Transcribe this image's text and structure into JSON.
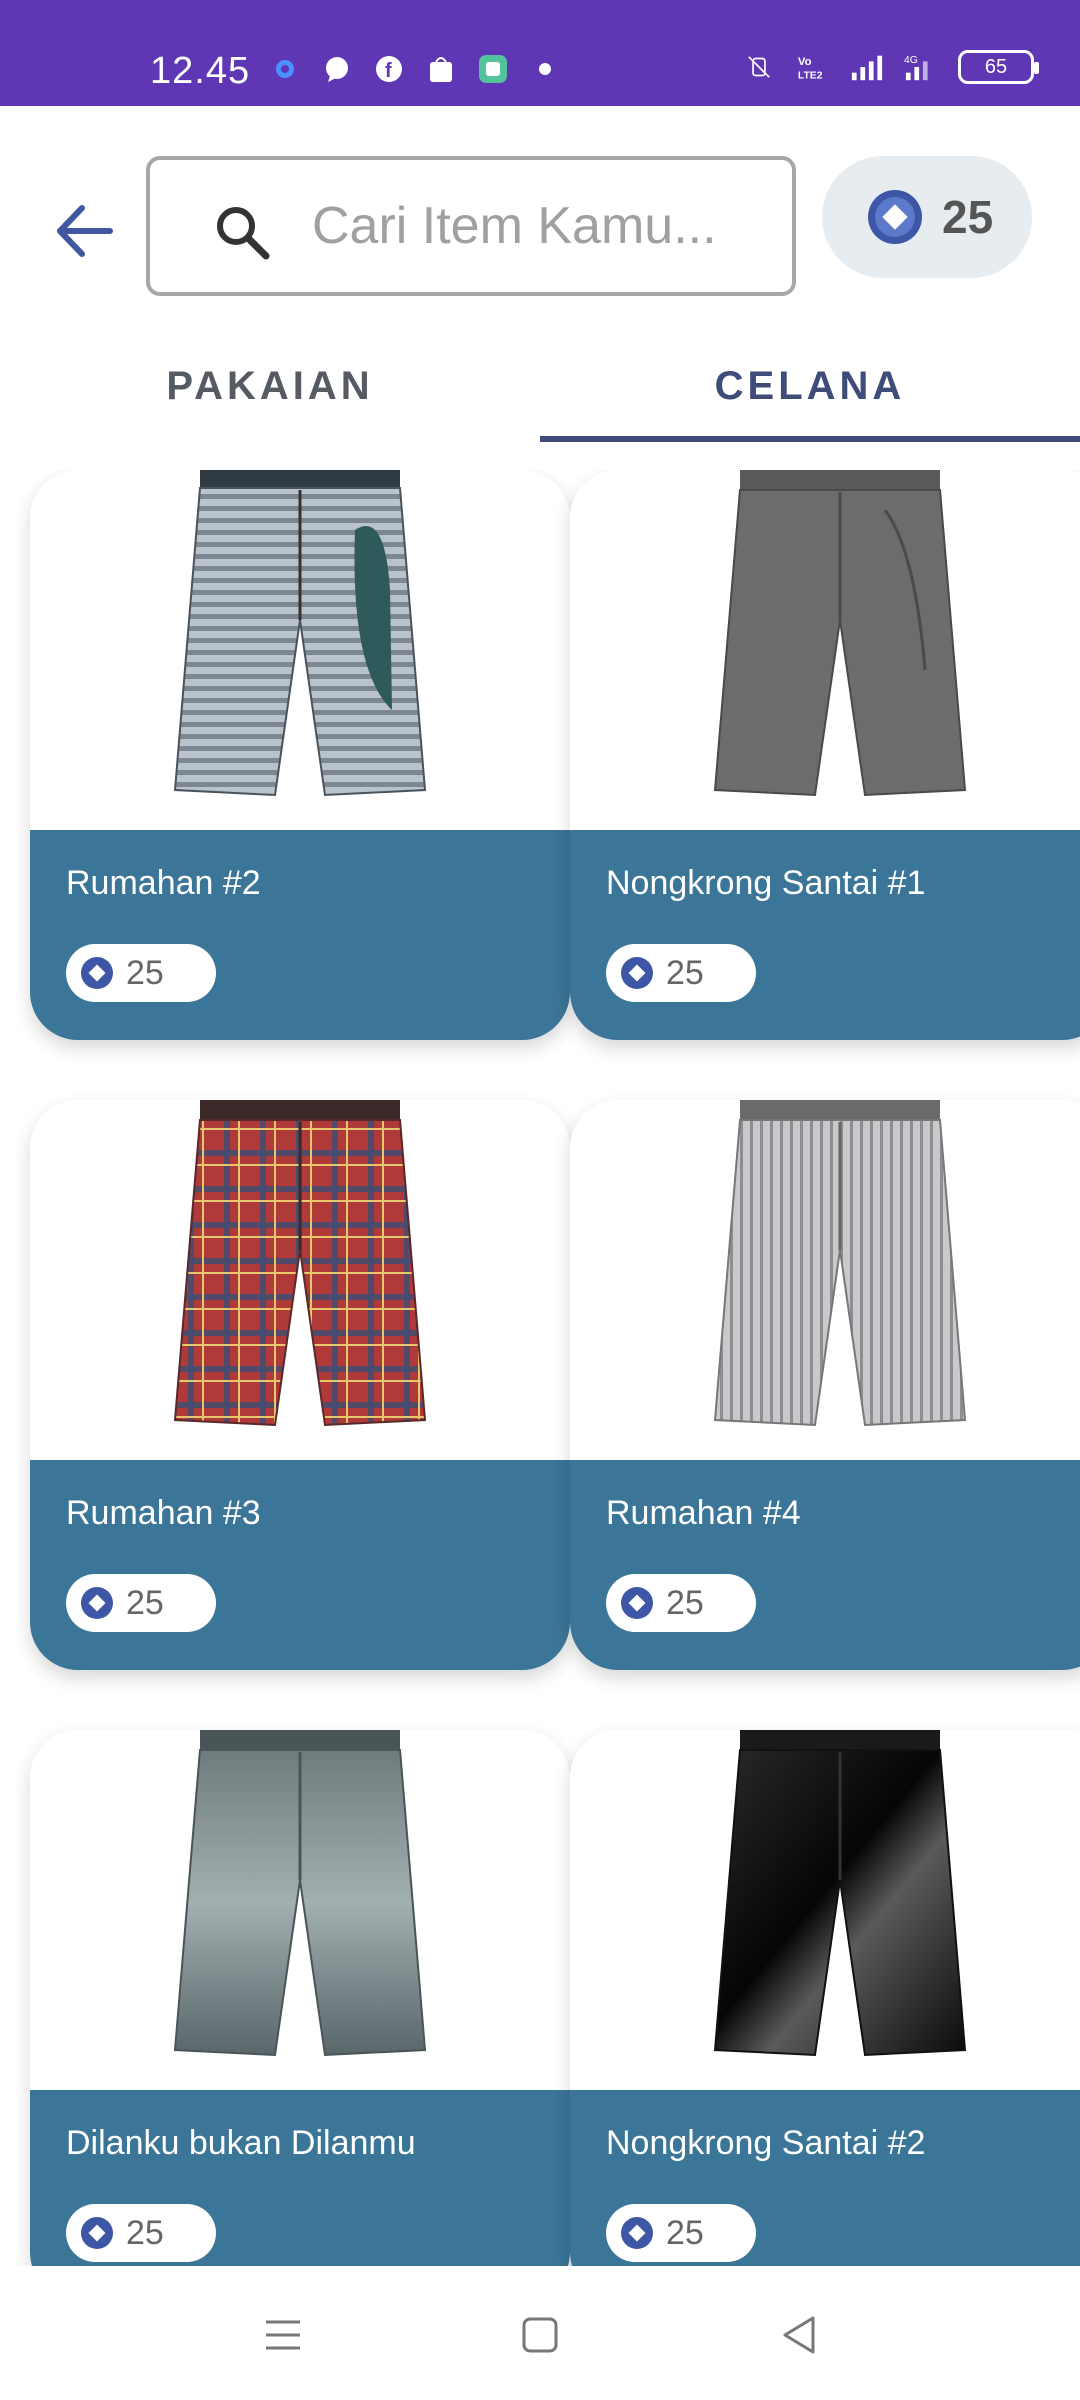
{
  "status_bar": {
    "time": "12.45",
    "battery": "65",
    "network_label": "4G",
    "volte_label": "Vo LTE2"
  },
  "header": {
    "search": {
      "placeholder": "Cari Item Kamu..."
    },
    "coins": "25"
  },
  "tabs": [
    {
      "label": "PAKAIAN",
      "active": false
    },
    {
      "label": "CELANA",
      "active": true
    }
  ],
  "items": [
    {
      "title": "Rumahan #2",
      "price": "25",
      "pattern": "grey-stripes"
    },
    {
      "title": "Nongkrong Santai #1",
      "price": "25",
      "pattern": "grey-plain"
    },
    {
      "title": "Rumahan #3",
      "price": "25",
      "pattern": "red-plaid"
    },
    {
      "title": "Rumahan #4",
      "price": "25",
      "pattern": "light-pinstripe"
    },
    {
      "title": "Dilanku bukan Dilanmu",
      "price": "25",
      "pattern": "denim"
    },
    {
      "title": "Nongkrong Santai #2",
      "price": "25",
      "pattern": "black-leather"
    }
  ],
  "colors": {
    "status_bar": "#5f36b3",
    "card_info": "#3b7597",
    "accent": "#3f4b79"
  }
}
